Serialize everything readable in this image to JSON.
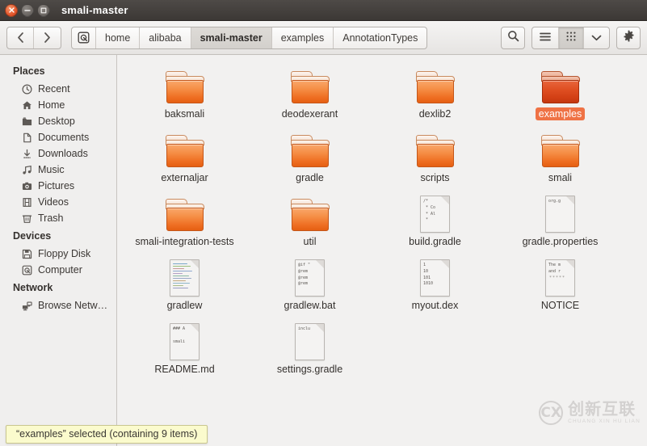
{
  "window": {
    "title": "smali-master",
    "buttons": {
      "close": "close-button",
      "minimize": "minimize-button",
      "maximize": "maximize-button"
    }
  },
  "toolbar": {
    "back_label": "‹",
    "forward_label": "›",
    "breadcrumbs": [
      {
        "label": "home",
        "active": false,
        "icon": false
      },
      {
        "label": "alibaba",
        "active": false,
        "icon": false
      },
      {
        "label": "smali-master",
        "active": true,
        "icon": false
      },
      {
        "label": "examples",
        "active": false,
        "icon": false
      },
      {
        "label": "AnnotationTypes",
        "active": false,
        "icon": false
      }
    ],
    "search_label": "search-icon",
    "list_view_label": "list-view-icon",
    "grid_view_label": "grid-view-icon",
    "view_menu_label": "chevron-down-icon",
    "settings_label": "gear-icon"
  },
  "sidebar": {
    "sections": [
      {
        "title": "Places",
        "items": [
          {
            "label": "Recent",
            "icon": "clock-icon"
          },
          {
            "label": "Home",
            "icon": "home-icon"
          },
          {
            "label": "Desktop",
            "icon": "desktop-folder-icon"
          },
          {
            "label": "Documents",
            "icon": "document-icon"
          },
          {
            "label": "Downloads",
            "icon": "download-icon"
          },
          {
            "label": "Music",
            "icon": "music-icon"
          },
          {
            "label": "Pictures",
            "icon": "camera-icon"
          },
          {
            "label": "Videos",
            "icon": "film-icon"
          },
          {
            "label": "Trash",
            "icon": "trash-icon"
          }
        ]
      },
      {
        "title": "Devices",
        "items": [
          {
            "label": "Floppy Disk",
            "icon": "floppy-disk-icon"
          },
          {
            "label": "Computer",
            "icon": "computer-icon"
          }
        ]
      },
      {
        "title": "Network",
        "items": [
          {
            "label": "Browse Netw…",
            "icon": "network-icon"
          }
        ]
      }
    ]
  },
  "files": [
    {
      "name": "baksmali",
      "type": "folder",
      "selected": false
    },
    {
      "name": "deodexerant",
      "type": "folder",
      "selected": false
    },
    {
      "name": "dexlib2",
      "type": "folder",
      "selected": false
    },
    {
      "name": "examples",
      "type": "folder",
      "selected": true
    },
    {
      "name": "externaljar",
      "type": "folder",
      "selected": false
    },
    {
      "name": "gradle",
      "type": "folder",
      "selected": false
    },
    {
      "name": "scripts",
      "type": "folder",
      "selected": false
    },
    {
      "name": "smali",
      "type": "folder",
      "selected": false
    },
    {
      "name": "smali-integration-tests",
      "type": "folder",
      "selected": false
    },
    {
      "name": "util",
      "type": "folder",
      "selected": false
    },
    {
      "name": "build.gradle",
      "type": "text",
      "selected": false,
      "preview": "/*\n * Co\n * Al\n *"
    },
    {
      "name": "gradle.properties",
      "type": "text",
      "selected": false,
      "preview": "org.g"
    },
    {
      "name": "gradlew",
      "type": "code",
      "selected": false,
      "preview": ""
    },
    {
      "name": "gradlew.bat",
      "type": "text",
      "selected": false,
      "preview": "@if \"\n@rem\n@rem\n@rem"
    },
    {
      "name": "myout.dex",
      "type": "text",
      "selected": false,
      "preview": "1\n10\n101\n1010"
    },
    {
      "name": "NOTICE",
      "type": "notice",
      "selected": false,
      "preview": "The m\nand r"
    },
    {
      "name": "README.md",
      "type": "text",
      "selected": false,
      "preview": "### A\n\nsmali"
    },
    {
      "name": "settings.gradle",
      "type": "text",
      "selected": false,
      "preview": "inclu"
    }
  ],
  "status": {
    "text": "“examples” selected (containing 9 items)"
  },
  "watermark": {
    "mark": "CX",
    "cn": "创新互联",
    "en": "CHUANG XIN HU LIAN"
  },
  "colors": {
    "accent": "#ef7245",
    "folder": "#f58e45",
    "folder_selected": "#df4f22",
    "status_bg": "#fbfbcd",
    "titlebar": "#3c3835"
  }
}
